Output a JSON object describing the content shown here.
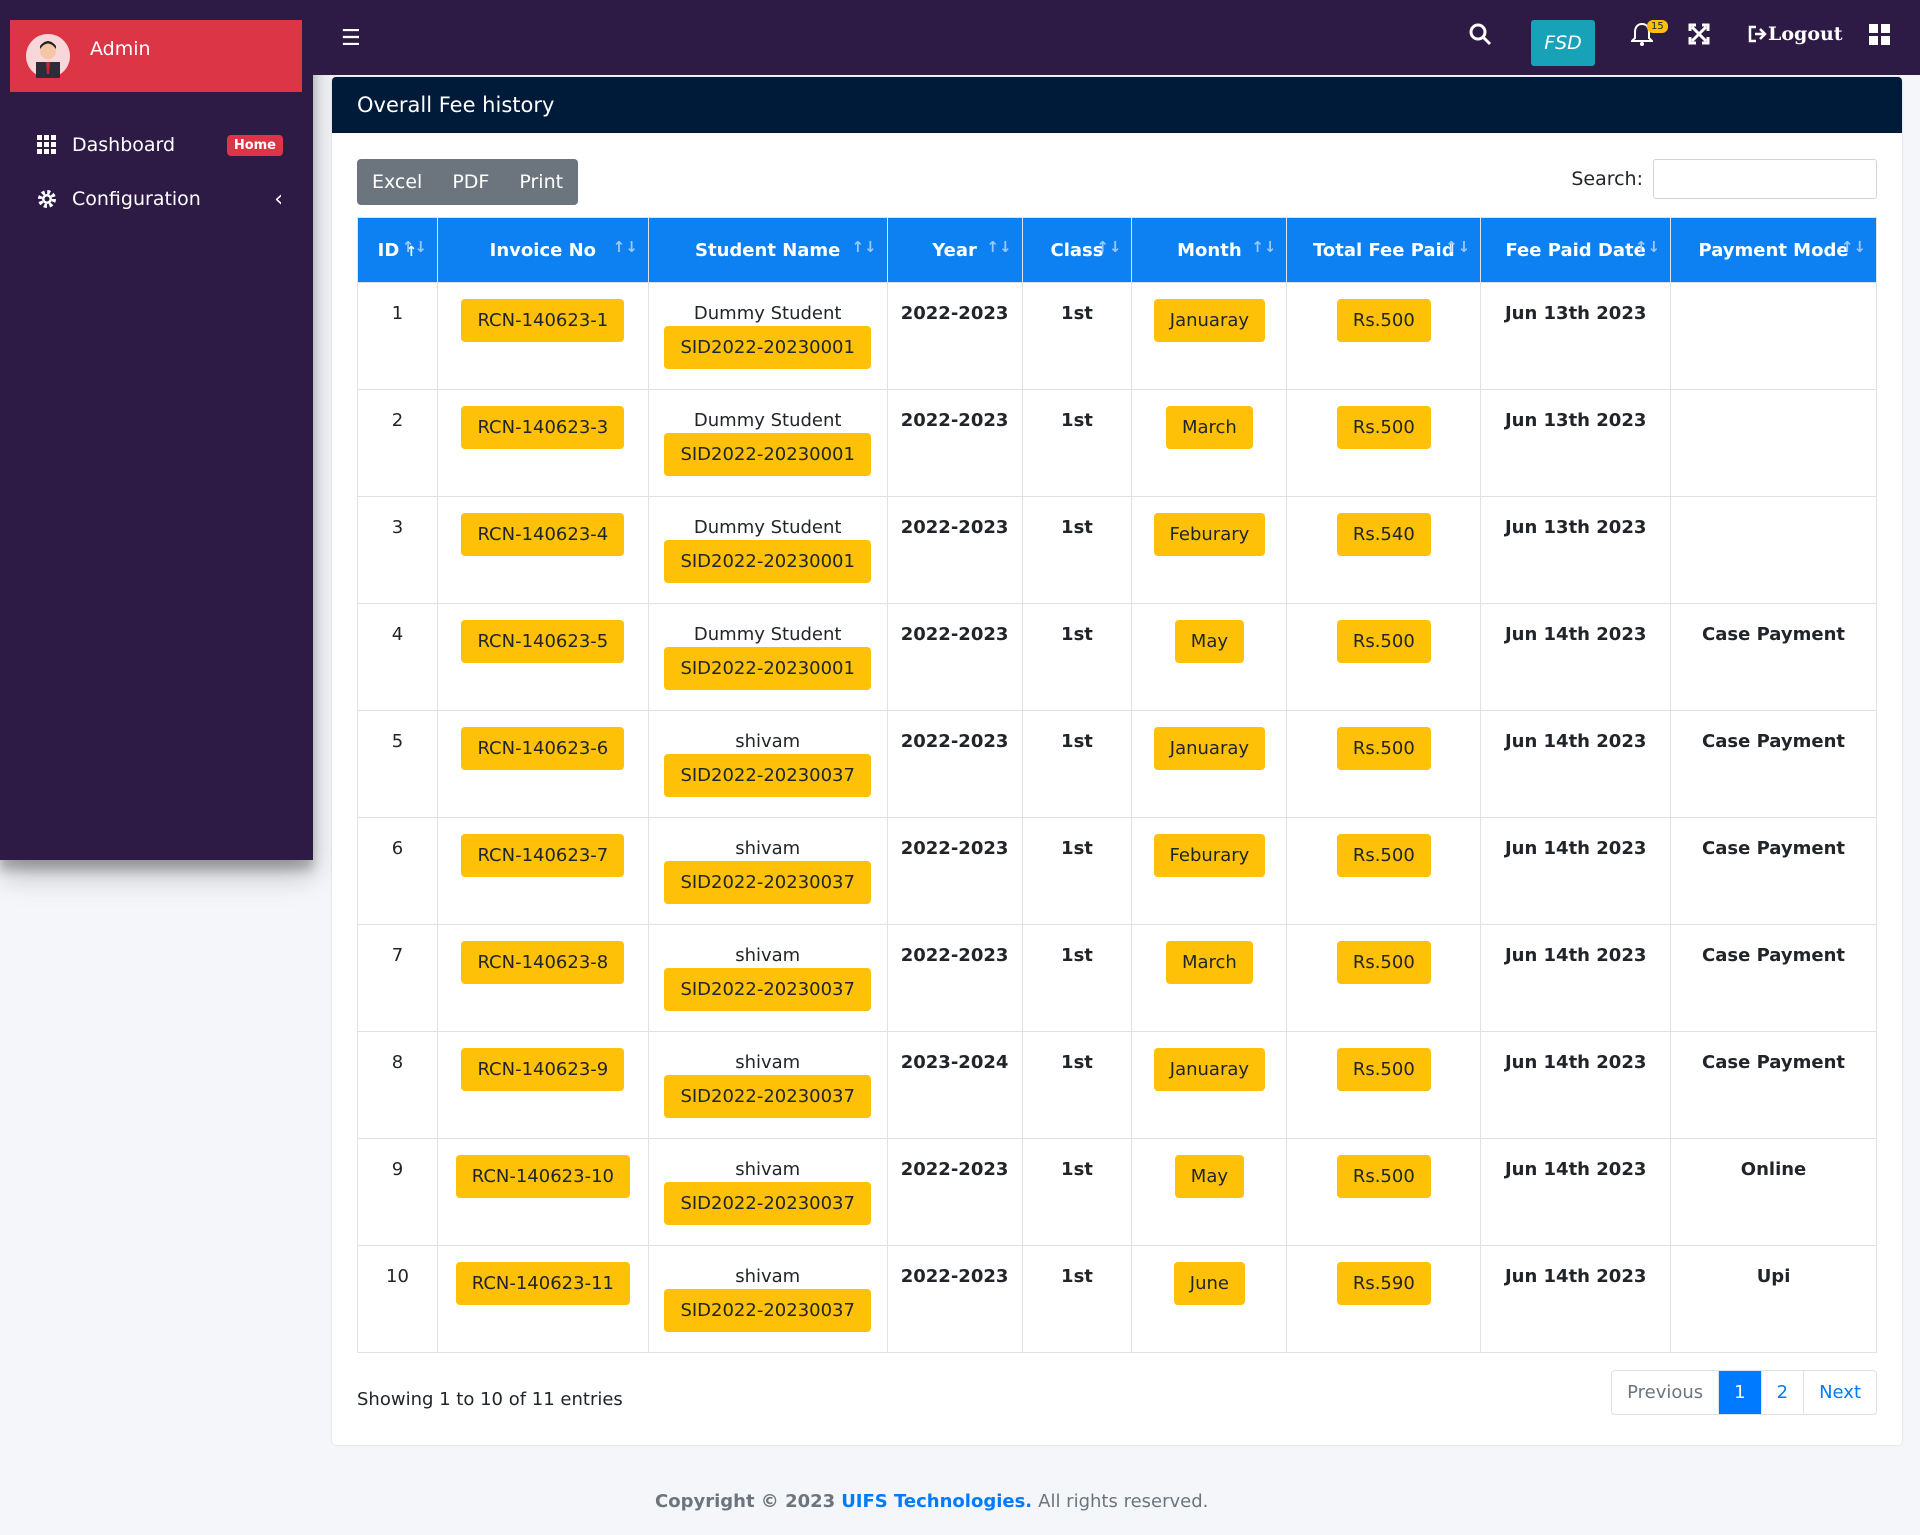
{
  "sidebar": {
    "user_name": "Admin",
    "items": [
      {
        "label": "Dashboard",
        "badge": "Home"
      },
      {
        "label": "Configuration"
      }
    ]
  },
  "topbar": {
    "fsd_label": "FSD",
    "notification_count": "15",
    "logout_label": "Logout"
  },
  "card": {
    "title": "Overall Fee history",
    "export_buttons": [
      "Excel",
      "PDF",
      "Print"
    ],
    "search_label": "Search:"
  },
  "table": {
    "columns": [
      "ID",
      "Invoice No",
      "Student Name",
      "Year",
      "Class",
      "Month",
      "Total Fee Paid",
      "Fee Paid Date",
      "Payment Mode"
    ],
    "rows": [
      {
        "id": "1",
        "invoice": "RCN-140623-1",
        "student": "Dummy Student",
        "sid": "SID2022-20230001",
        "year": "2022-2023",
        "class": "1st",
        "month": "Januaray",
        "fee": "Rs.500",
        "date": "Jun 13th 2023",
        "mode": ""
      },
      {
        "id": "2",
        "invoice": "RCN-140623-3",
        "student": "Dummy Student",
        "sid": "SID2022-20230001",
        "year": "2022-2023",
        "class": "1st",
        "month": "March",
        "fee": "Rs.500",
        "date": "Jun 13th 2023",
        "mode": ""
      },
      {
        "id": "3",
        "invoice": "RCN-140623-4",
        "student": "Dummy Student",
        "sid": "SID2022-20230001",
        "year": "2022-2023",
        "class": "1st",
        "month": "Feburary",
        "fee": "Rs.540",
        "date": "Jun 13th 2023",
        "mode": ""
      },
      {
        "id": "4",
        "invoice": "RCN-140623-5",
        "student": "Dummy Student",
        "sid": "SID2022-20230001",
        "year": "2022-2023",
        "class": "1st",
        "month": "May",
        "fee": "Rs.500",
        "date": "Jun 14th 2023",
        "mode": "Case Payment"
      },
      {
        "id": "5",
        "invoice": "RCN-140623-6",
        "student": "shivam",
        "sid": "SID2022-20230037",
        "year": "2022-2023",
        "class": "1st",
        "month": "Januaray",
        "fee": "Rs.500",
        "date": "Jun 14th 2023",
        "mode": "Case Payment"
      },
      {
        "id": "6",
        "invoice": "RCN-140623-7",
        "student": "shivam",
        "sid": "SID2022-20230037",
        "year": "2022-2023",
        "class": "1st",
        "month": "Feburary",
        "fee": "Rs.500",
        "date": "Jun 14th 2023",
        "mode": "Case Payment"
      },
      {
        "id": "7",
        "invoice": "RCN-140623-8",
        "student": "shivam",
        "sid": "SID2022-20230037",
        "year": "2022-2023",
        "class": "1st",
        "month": "March",
        "fee": "Rs.500",
        "date": "Jun 14th 2023",
        "mode": "Case Payment"
      },
      {
        "id": "8",
        "invoice": "RCN-140623-9",
        "student": "shivam",
        "sid": "SID2022-20230037",
        "year": "2023-2024",
        "class": "1st",
        "month": "Januaray",
        "fee": "Rs.500",
        "date": "Jun 14th 2023",
        "mode": "Case Payment"
      },
      {
        "id": "9",
        "invoice": "RCN-140623-10",
        "student": "shivam",
        "sid": "SID2022-20230037",
        "year": "2022-2023",
        "class": "1st",
        "month": "May",
        "fee": "Rs.500",
        "date": "Jun 14th 2023",
        "mode": "Online"
      },
      {
        "id": "10",
        "invoice": "RCN-140623-11",
        "student": "shivam",
        "sid": "SID2022-20230037",
        "year": "2022-2023",
        "class": "1st",
        "month": "June",
        "fee": "Rs.590",
        "date": "Jun 14th 2023",
        "mode": "Upi"
      }
    ]
  },
  "pagination": {
    "info": "Showing 1 to 10 of 11 entries",
    "previous": "Previous",
    "pages": [
      "1",
      "2"
    ],
    "next": "Next"
  },
  "footer": {
    "lead": "Copyright © 2023",
    "company": "UIFS Technologies.",
    "tail": "All rights reserved."
  },
  "colors": {
    "sidebar_bg": "#2d1b45",
    "brand_bg": "#dc3545",
    "header_bg": "#001a3a",
    "table_head": "#0d80f2",
    "pill": "#ffc107",
    "fsd": "#17a2b8"
  }
}
